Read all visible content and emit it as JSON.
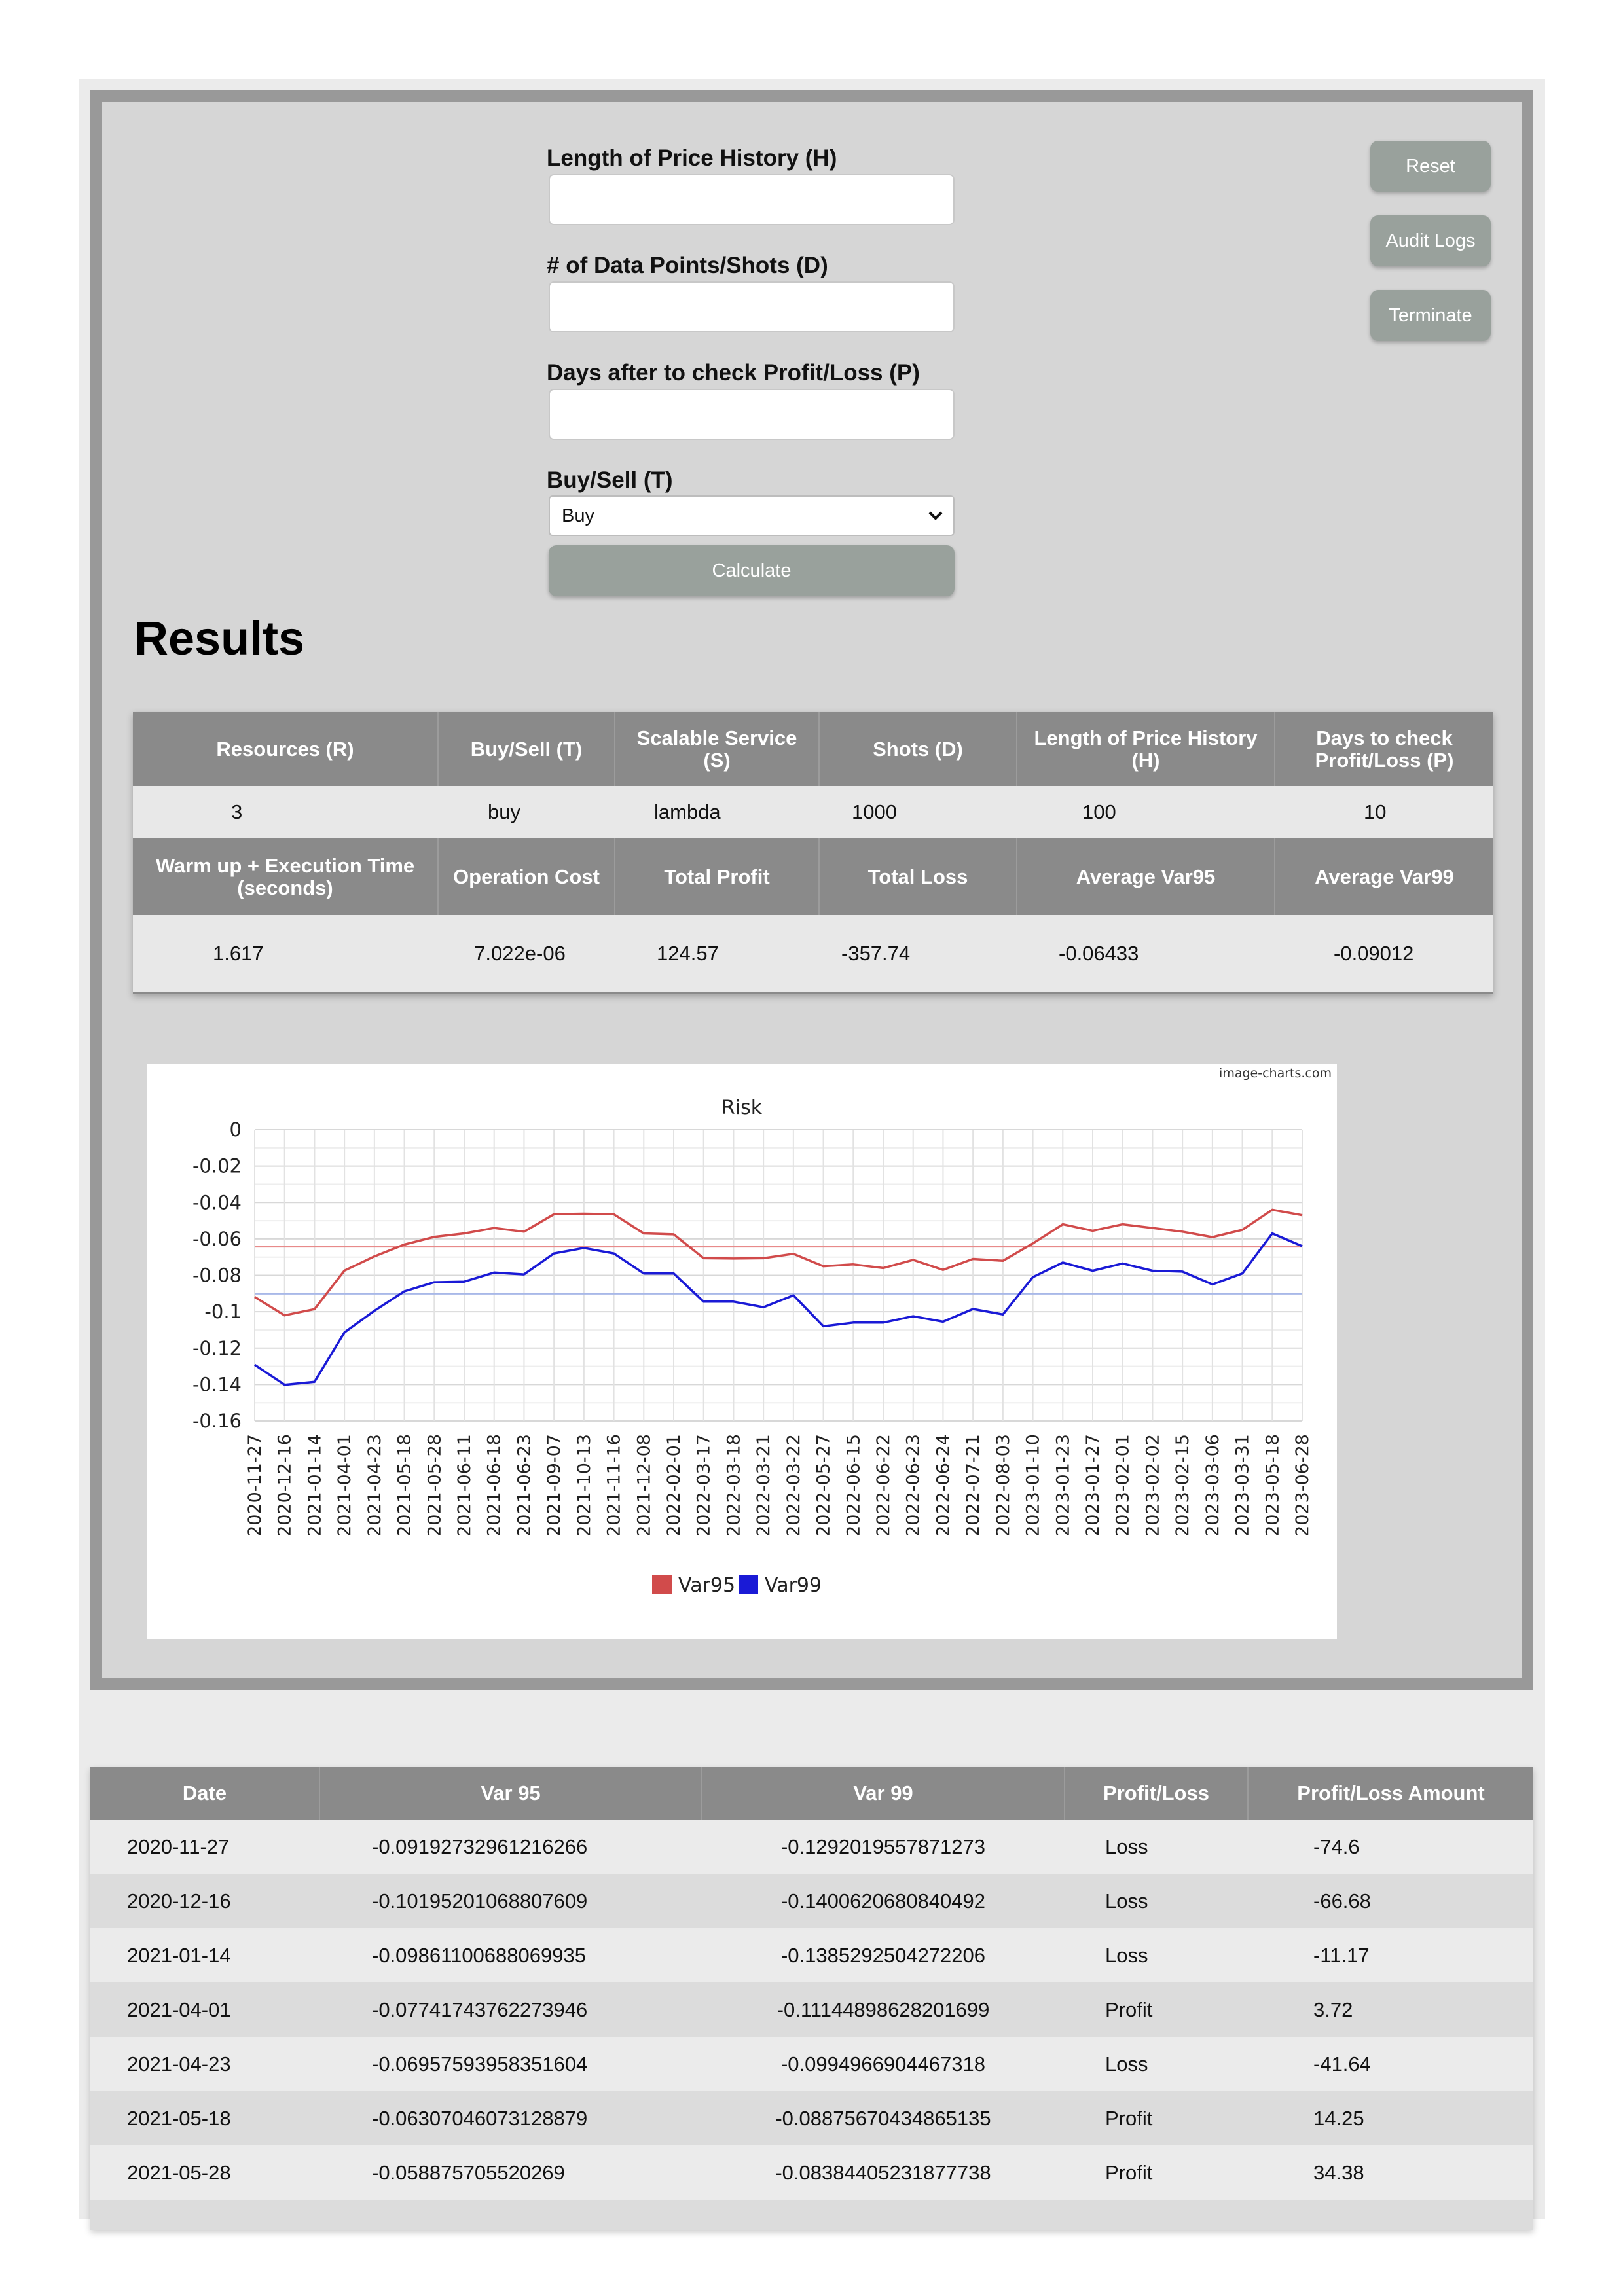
{
  "form": {
    "price_history_label": "Length of Price History (H)",
    "shots_label": "# of Data Points/Shots (D)",
    "days_label": "Days after to check Profit/Loss (P)",
    "buysell_label": "Buy/Sell (T)",
    "buysell_value": "Buy",
    "calculate_label": "Calculate"
  },
  "side_buttons": {
    "reset": "Reset",
    "audit": "Audit Logs",
    "terminate": "Terminate"
  },
  "results": {
    "title": "Results",
    "headers1": [
      "Resources (R)",
      "Buy/Sell (T)",
      "Scalable Service (S)",
      "Shots (D)",
      "Length of Price History (H)",
      "Days to check Profit/Loss (P)"
    ],
    "values1": [
      "3",
      "buy",
      "lambda",
      "1000",
      "100",
      "10"
    ],
    "headers2": [
      "Warm up + Execution Time (seconds)",
      "Operation Cost",
      "Total Profit",
      "Total Loss",
      "Average Var95",
      "Average Var99"
    ],
    "values2": [
      "1.617",
      "7.022e-06",
      "124.57",
      "-357.74",
      "-0.06433",
      "-0.09012"
    ]
  },
  "chart_watermark": "image-charts.com",
  "chart_data": {
    "type": "line",
    "title": "Risk",
    "xlabel": "",
    "ylabel": "",
    "ylim": [
      -0.16,
      0
    ],
    "yticks": [
      0,
      -0.02,
      -0.04,
      -0.06,
      -0.08,
      -0.1,
      -0.12,
      -0.14,
      -0.16
    ],
    "ytick_labels": [
      "0",
      "-0.02",
      "-0.04",
      "-0.06",
      "-0.08",
      "-0.1",
      "-0.12",
      "-0.14",
      "-0.16"
    ],
    "grid": true,
    "legend_position": "bottom",
    "x": [
      "2020-11-27",
      "2020-12-16",
      "2021-01-14",
      "2021-04-01",
      "2021-04-23",
      "2021-05-18",
      "2021-05-28",
      "2021-06-11",
      "2021-06-18",
      "2021-06-23",
      "2021-09-07",
      "2021-10-13",
      "2021-11-16",
      "2021-12-08",
      "2022-02-01",
      "2022-03-17",
      "2022-03-18",
      "2022-03-21",
      "2022-03-22",
      "2022-05-27",
      "2022-06-15",
      "2022-06-22",
      "2022-06-23",
      "2022-06-24",
      "2022-07-21",
      "2022-08-03",
      "2023-01-10",
      "2023-01-23",
      "2023-01-27",
      "2023-02-01",
      "2023-02-02",
      "2023-02-15",
      "2023-03-06",
      "2023-03-31",
      "2023-05-18",
      "2023-06-28"
    ],
    "series": [
      {
        "name": "Var95",
        "color": "#d14b4b",
        "values": [
          -0.0919,
          -0.102,
          -0.0986,
          -0.0774,
          -0.0696,
          -0.0631,
          -0.0589,
          -0.057,
          -0.054,
          -0.056,
          -0.0465,
          -0.0462,
          -0.0465,
          -0.057,
          -0.0575,
          -0.0706,
          -0.0708,
          -0.0706,
          -0.0682,
          -0.075,
          -0.074,
          -0.076,
          -0.0715,
          -0.077,
          -0.071,
          -0.072,
          -0.0625,
          -0.052,
          -0.0555,
          -0.052,
          -0.054,
          -0.056,
          -0.059,
          -0.055,
          -0.044,
          -0.047
        ]
      },
      {
        "name": "Var99",
        "color": "#1a1ad6",
        "values": [
          -0.1292,
          -0.1401,
          -0.1385,
          -0.1114,
          -0.0995,
          -0.0888,
          -0.0838,
          -0.0835,
          -0.0785,
          -0.0795,
          -0.068,
          -0.065,
          -0.068,
          -0.079,
          -0.079,
          -0.0945,
          -0.0945,
          -0.0975,
          -0.091,
          -0.108,
          -0.106,
          -0.106,
          -0.1025,
          -0.1055,
          -0.0985,
          -0.1015,
          -0.081,
          -0.073,
          -0.0775,
          -0.0735,
          -0.0775,
          -0.078,
          -0.085,
          -0.079,
          -0.057,
          -0.064
        ]
      }
    ],
    "reference_lines": [
      {
        "series": "Var95",
        "value": -0.06433,
        "color": "#e88a8a"
      },
      {
        "series": "Var99",
        "value": -0.09012,
        "color": "#a8b8e8"
      }
    ]
  },
  "history": {
    "headers": [
      "Date",
      "Var 95",
      "Var 99",
      "Profit/Loss",
      "Profit/Loss Amount"
    ],
    "rows": [
      [
        "2020-11-27",
        "-0.09192732961216266",
        "-0.1292019557871273",
        "Loss",
        "-74.6"
      ],
      [
        "2020-12-16",
        "-0.10195201068807609",
        "-0.1400620680840492",
        "Loss",
        "-66.68"
      ],
      [
        "2021-01-14",
        "-0.09861100688069935",
        "-0.1385292504272206",
        "Loss",
        "-11.17"
      ],
      [
        "2021-04-01",
        "-0.07741743762273946",
        "-0.11144898628201699",
        "Profit",
        "3.72"
      ],
      [
        "2021-04-23",
        "-0.06957593958351604",
        "-0.0994966904467318",
        "Loss",
        "-41.64"
      ],
      [
        "2021-05-18",
        "-0.06307046073128879",
        "-0.08875670434865135",
        "Profit",
        "14.25"
      ],
      [
        "2021-05-28",
        "-0.058875705520269",
        "-0.08384405231877738",
        "Profit",
        "34.38"
      ]
    ]
  }
}
